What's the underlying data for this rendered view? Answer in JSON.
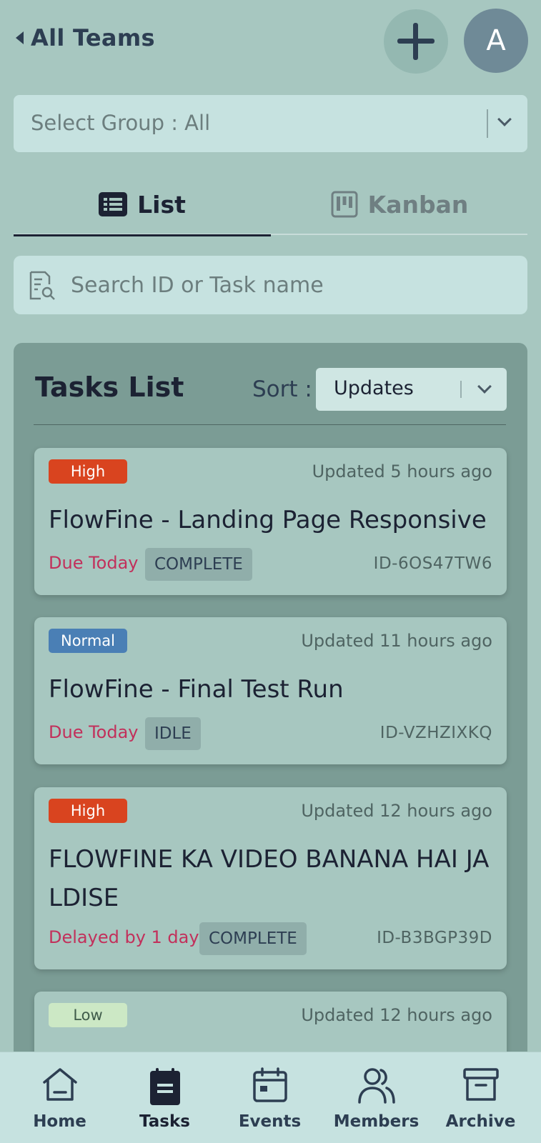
{
  "header": {
    "back_label": "All Teams",
    "add_icon": "plus-icon",
    "avatar_initial": "A"
  },
  "group_select": {
    "value": "Select Group : All"
  },
  "view_tabs": [
    {
      "label": "List",
      "icon": "list-icon",
      "active": true
    },
    {
      "label": "Kanban",
      "icon": "kanban-icon",
      "active": false
    }
  ],
  "search": {
    "placeholder": "Search ID or Task name",
    "value": ""
  },
  "tasks_panel": {
    "title": "Tasks List",
    "sort_label": "Sort :",
    "sort_value": "Updates"
  },
  "tasks": [
    {
      "priority": "High",
      "updated": "Updated 5 hours ago",
      "title": "FlowFine - Landing Page Responsive",
      "due": "Due Today",
      "status": "COMPLETE",
      "id": "ID-6OS47TW6"
    },
    {
      "priority": "Normal",
      "updated": "Updated 11 hours ago",
      "title": "FlowFine - Final Test Run",
      "due": "Due Today",
      "status": "IDLE",
      "id": "ID-VZHZIXKQ"
    },
    {
      "priority": "High",
      "updated": "Updated 12 hours ago",
      "title": "FLOWFINE KA VIDEO BANANA HAI JA LDISE",
      "due": "Delayed by 1 day",
      "status": "COMPLETE",
      "id": "ID-B3BGP39D"
    },
    {
      "priority": "Low",
      "updated": "Updated 12 hours ago"
    }
  ],
  "bottom_nav": [
    {
      "label": "Home",
      "icon": "home-icon"
    },
    {
      "label": "Tasks",
      "icon": "tasks-icon",
      "active": true
    },
    {
      "label": "Events",
      "icon": "calendar-icon"
    },
    {
      "label": "Members",
      "icon": "members-icon"
    },
    {
      "label": "Archive",
      "icon": "archive-icon"
    }
  ],
  "colors": {
    "background": "#a7c7c0",
    "priority_high": "#d9441f",
    "priority_normal": "#4a7fb5",
    "priority_low": "#cce8c5",
    "due_text": "#c2305b"
  }
}
